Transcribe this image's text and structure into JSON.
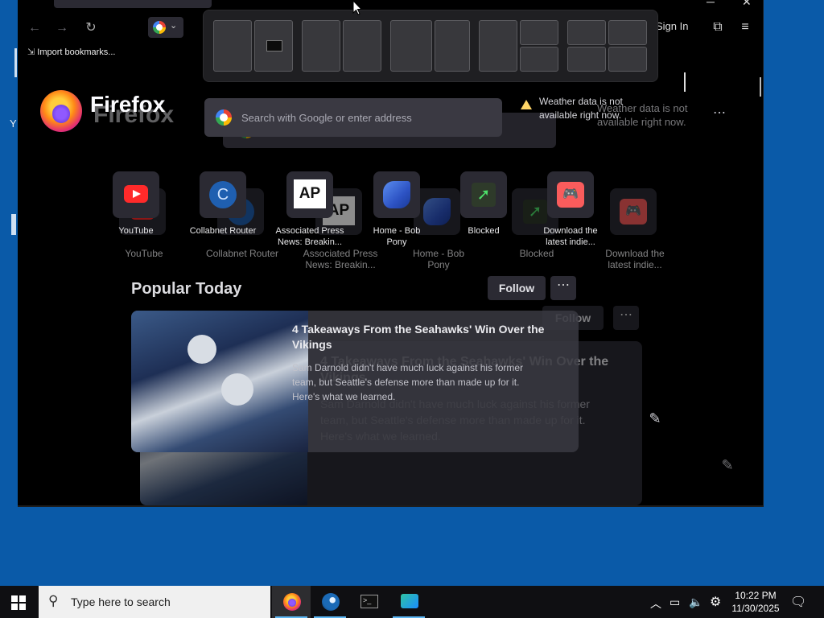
{
  "desktop": {
    "left_fragments": [
      "Y"
    ]
  },
  "browser": {
    "bookmarks": {
      "import_label": "Import bookmarks..."
    },
    "toolbar": {
      "sign_in_label": "Sign In"
    },
    "snap_layout_options": 5
  },
  "newtab": {
    "brand_name": "Firefox",
    "search": {
      "placeholder": "Search with Google or enter address"
    },
    "weather": {
      "message_line1": "Weather data is not",
      "message_line2": "available right now."
    },
    "ghost_weather": {
      "line1": "Weather data is not",
      "line2": "available right now."
    },
    "shortcuts": [
      {
        "label_line1": "YouTube",
        "label_line2": "",
        "icon": "youtube-icon"
      },
      {
        "label_line1": "Collabnet Router",
        "label_line2": "",
        "icon": "c-letter-icon"
      },
      {
        "label_line1": "Associated Press",
        "label_line2": "News: Breakin...",
        "icon": "ap-logo-icon"
      },
      {
        "label_line1": "Home - Bob",
        "label_line2": "Pony",
        "icon": "pony-icon"
      },
      {
        "label_line1": "Blocked",
        "label_line2": "",
        "icon": "blocked-arrow-icon"
      },
      {
        "label_line1": "Download the",
        "label_line2": "latest indie...",
        "icon": "itch-icon"
      }
    ],
    "popular": {
      "title": "Popular Today",
      "follow_label": "Follow",
      "article": {
        "title_line1": "4 Takeaways From the Seahawks' Win Over the",
        "title_line2": "Vikings",
        "desc_line1": "Sam Darnold didn't have much luck against his former",
        "desc_line2": "team, but Seattle's defense more than made up for it.",
        "desc_line3": "Here's what we learned."
      }
    }
  },
  "taskbar": {
    "search_placeholder": "Type here to search",
    "clock_time": "10:22 PM",
    "clock_date": "11/30/2025",
    "apps": [
      "firefox-icon",
      "steam-icon",
      "terminal-icon",
      "snipping-tool-icon"
    ]
  }
}
